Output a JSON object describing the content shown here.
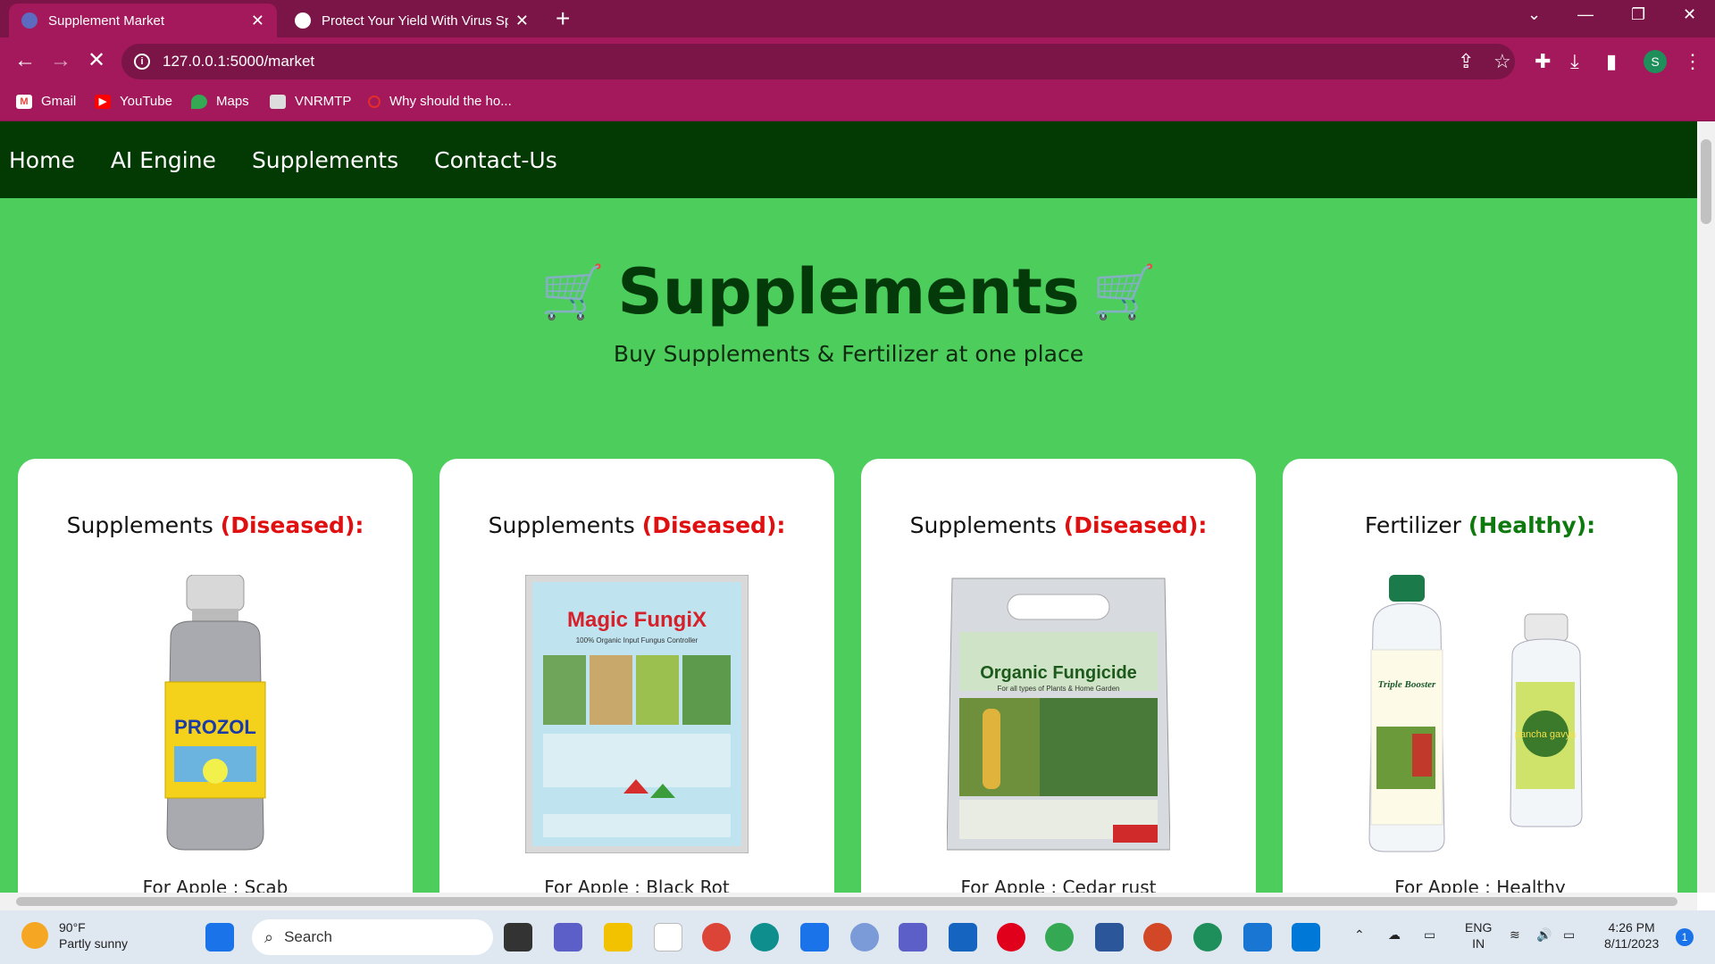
{
  "browser": {
    "tabs": [
      {
        "title": "Supplement Market",
        "active": true
      },
      {
        "title": "Protect Your Yield With Virus Spe",
        "active": false
      }
    ],
    "url": "127.0.0.1:5000/market",
    "bookmarks": [
      "Gmail",
      "YouTube",
      "Maps",
      "VNRMTP",
      "Why should the ho..."
    ],
    "profile_initial": "S"
  },
  "site": {
    "nav": [
      "Home",
      "AI Engine",
      "Supplements",
      "Contact-Us"
    ],
    "title": "Supplements",
    "subtitle": "Buy Supplements & Fertilizer at one place",
    "cards": [
      {
        "heading": "Supplements",
        "status": "(Diseased):",
        "product_label": "PROZOL",
        "caption": "For Apple : Scab"
      },
      {
        "heading": "Supplements",
        "status": "(Diseased):",
        "product_label": "Magic FungiX",
        "product_sub": "100% Organic Input Fungus Controller",
        "caption": "For Apple : Black Rot"
      },
      {
        "heading": "Supplements",
        "status": "(Diseased):",
        "product_label": "Organic Fungicide",
        "product_sub": "For all types of Plants & Home Garden",
        "caption": "For Apple : Cedar rust"
      },
      {
        "heading": "Fertilizer",
        "status": "(Healthy):",
        "product_label": "Triple Booster",
        "product_label2": "pancha gavya",
        "caption": "For Apple : Healthy"
      }
    ]
  },
  "taskbar": {
    "weather_temp": "90°F",
    "weather_desc": "Partly sunny",
    "search": "Search",
    "lang": "ENG",
    "region": "IN",
    "time": "4:26 PM",
    "date": "8/11/2023",
    "notifications": "1"
  },
  "colors": {
    "page_bg": "#4ccd5c",
    "nav_bg": "#033a03",
    "diseased": "#e01010",
    "healthy": "#0e7a0e",
    "chrome": "#a3195b"
  }
}
